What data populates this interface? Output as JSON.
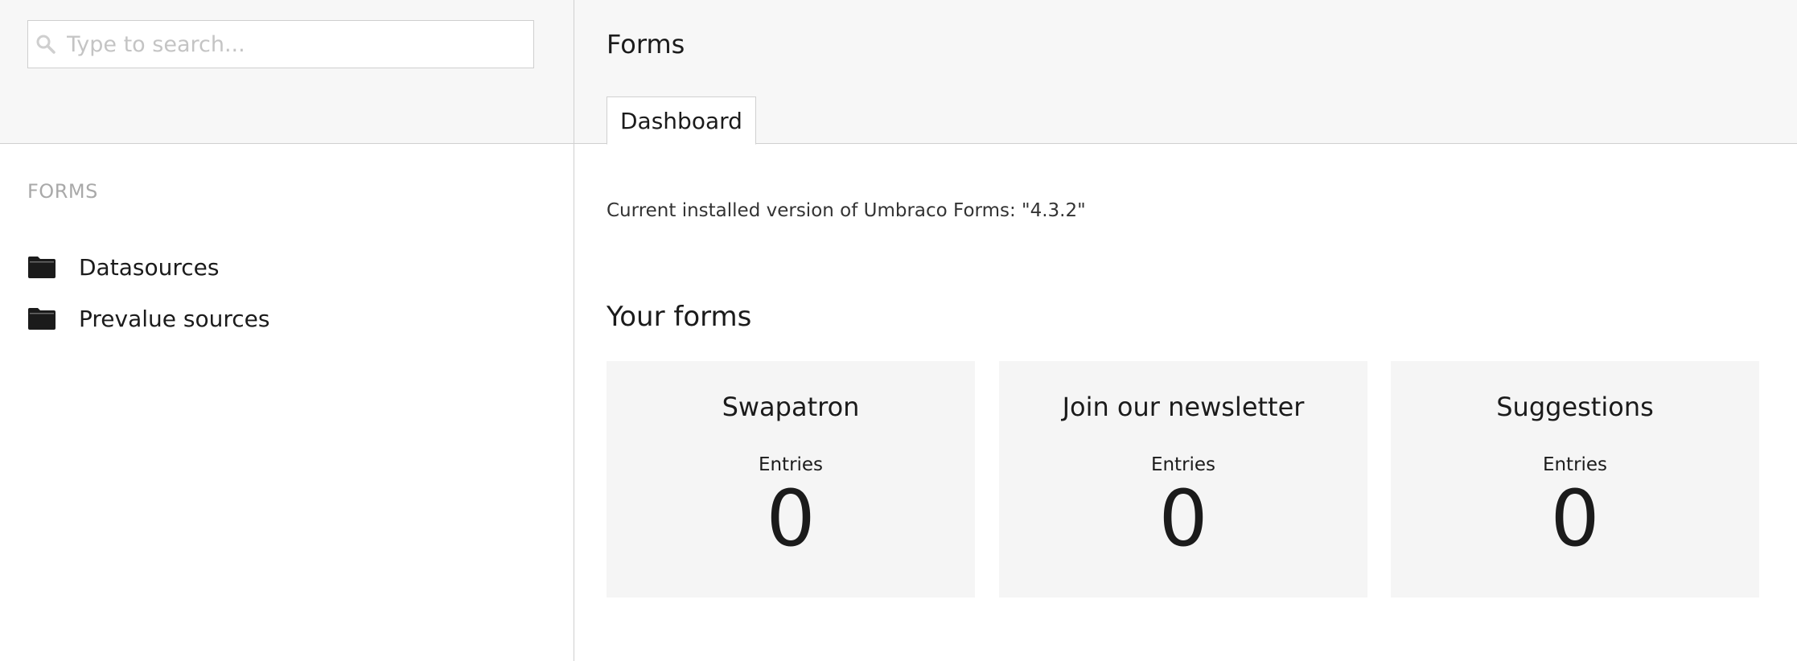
{
  "search": {
    "placeholder": "Type to search...",
    "value": ""
  },
  "tree": {
    "section_title": "FORMS",
    "items": [
      {
        "label": "Datasources",
        "icon": "folder-icon"
      },
      {
        "label": "Prevalue sources",
        "icon": "folder-icon"
      }
    ]
  },
  "header": {
    "title": "Forms",
    "tabs": [
      {
        "label": "Dashboard",
        "active": true
      }
    ]
  },
  "dashboard": {
    "version_text": "Current installed version of Umbraco Forms: \"4.3.2\"",
    "forms_heading": "Your forms",
    "forms": [
      {
        "name": "Swapatron",
        "entries_label": "Entries",
        "entries_count": "0"
      },
      {
        "name": "Join our newsletter",
        "entries_label": "Entries",
        "entries_count": "0"
      },
      {
        "name": "Suggestions",
        "entries_label": "Entries",
        "entries_count": "0"
      }
    ]
  },
  "colors": {
    "header_bg": "#f7f7f7",
    "card_bg": "#f5f5f5",
    "border": "#d0d0d0",
    "muted_text": "#a9a9a9",
    "text": "#1b1b1b"
  }
}
